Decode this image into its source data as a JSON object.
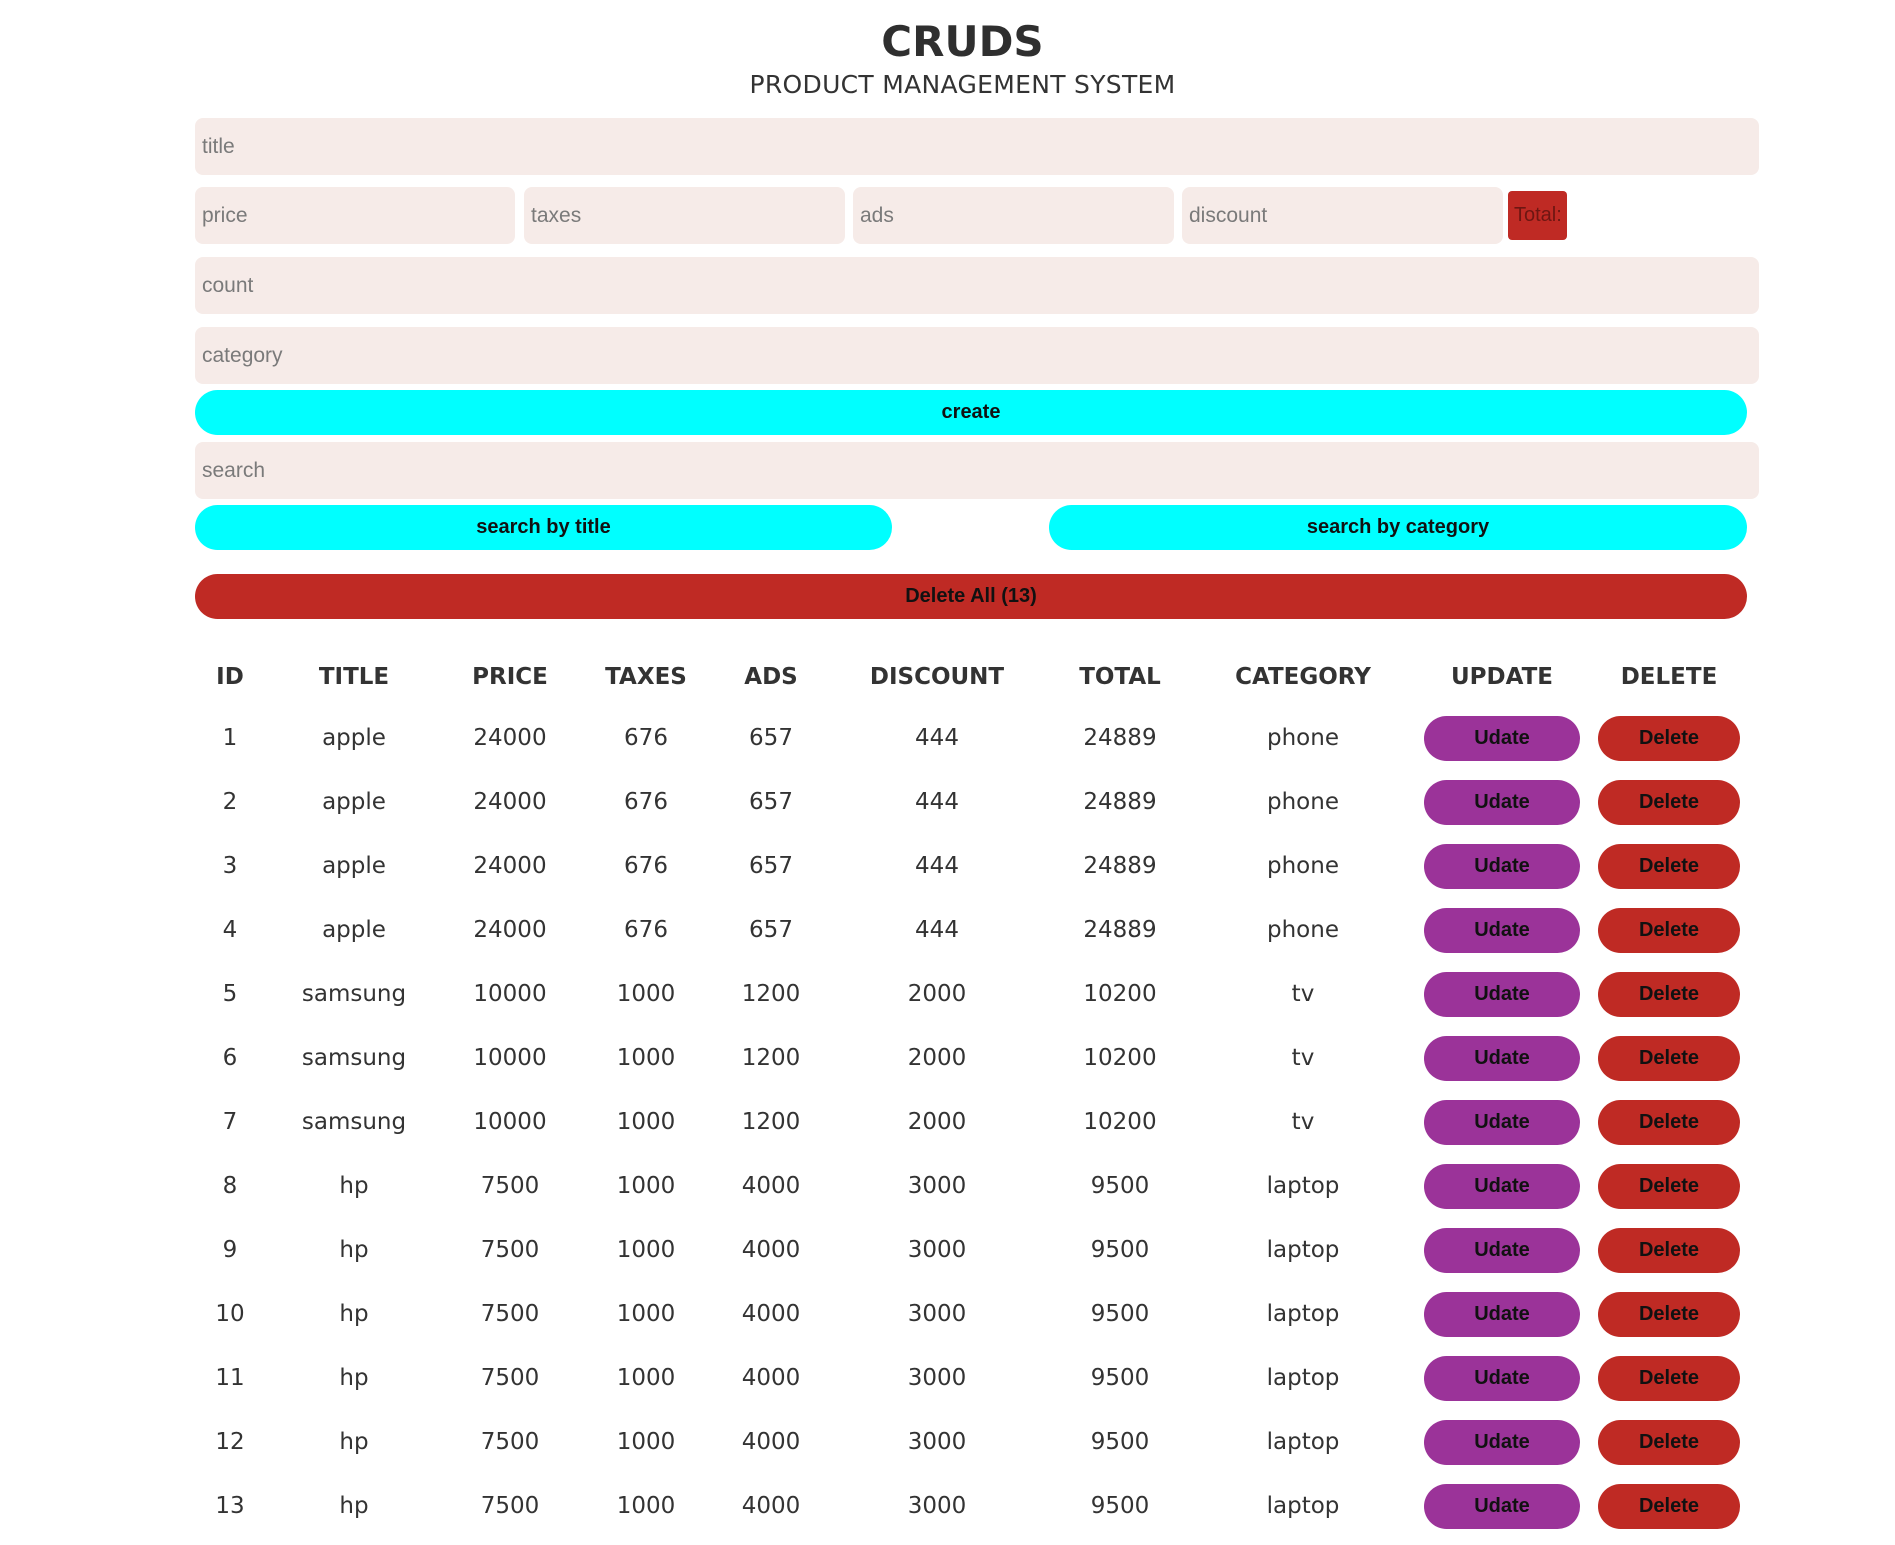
{
  "header": {
    "title": "CRUDS",
    "subtitle": "PRODUCT MANAGEMENT SYSTEM"
  },
  "form": {
    "title_placeholder": "title",
    "price_placeholder": "price",
    "taxes_placeholder": "taxes",
    "ads_placeholder": "ads",
    "discount_placeholder": "discount",
    "total_label": "Total:",
    "count_placeholder": "count",
    "category_placeholder": "category",
    "create_label": "create"
  },
  "search": {
    "placeholder": "search",
    "by_title_label": "search by title",
    "by_category_label": "search by category"
  },
  "delete_all_label": "Delete All (13)",
  "table": {
    "headers": [
      "ID",
      "TITLE",
      "PRICE",
      "TAXES",
      "ADS",
      "DISCOUNT",
      "TOTAL",
      "CATEGORY",
      "UPDATE",
      "DELETE"
    ],
    "update_label": "Udate",
    "delete_label": "Delete",
    "rows": [
      {
        "id": "1",
        "title": "apple",
        "price": "24000",
        "taxes": "676",
        "ads": "657",
        "discount": "444",
        "total": "24889",
        "category": "phone"
      },
      {
        "id": "2",
        "title": "apple",
        "price": "24000",
        "taxes": "676",
        "ads": "657",
        "discount": "444",
        "total": "24889",
        "category": "phone"
      },
      {
        "id": "3",
        "title": "apple",
        "price": "24000",
        "taxes": "676",
        "ads": "657",
        "discount": "444",
        "total": "24889",
        "category": "phone"
      },
      {
        "id": "4",
        "title": "apple",
        "price": "24000",
        "taxes": "676",
        "ads": "657",
        "discount": "444",
        "total": "24889",
        "category": "phone"
      },
      {
        "id": "5",
        "title": "samsung",
        "price": "10000",
        "taxes": "1000",
        "ads": "1200",
        "discount": "2000",
        "total": "10200",
        "category": "tv"
      },
      {
        "id": "6",
        "title": "samsung",
        "price": "10000",
        "taxes": "1000",
        "ads": "1200",
        "discount": "2000",
        "total": "10200",
        "category": "tv"
      },
      {
        "id": "7",
        "title": "samsung",
        "price": "10000",
        "taxes": "1000",
        "ads": "1200",
        "discount": "2000",
        "total": "10200",
        "category": "tv"
      },
      {
        "id": "8",
        "title": "hp",
        "price": "7500",
        "taxes": "1000",
        "ads": "4000",
        "discount": "3000",
        "total": "9500",
        "category": "laptop"
      },
      {
        "id": "9",
        "title": "hp",
        "price": "7500",
        "taxes": "1000",
        "ads": "4000",
        "discount": "3000",
        "total": "9500",
        "category": "laptop"
      },
      {
        "id": "10",
        "title": "hp",
        "price": "7500",
        "taxes": "1000",
        "ads": "4000",
        "discount": "3000",
        "total": "9500",
        "category": "laptop"
      },
      {
        "id": "11",
        "title": "hp",
        "price": "7500",
        "taxes": "1000",
        "ads": "4000",
        "discount": "3000",
        "total": "9500",
        "category": "laptop"
      },
      {
        "id": "12",
        "title": "hp",
        "price": "7500",
        "taxes": "1000",
        "ads": "4000",
        "discount": "3000",
        "total": "9500",
        "category": "laptop"
      },
      {
        "id": "13",
        "title": "hp",
        "price": "7500",
        "taxes": "1000",
        "ads": "4000",
        "discount": "3000",
        "total": "9500",
        "category": "laptop"
      }
    ]
  },
  "colors": {
    "input_bg": "#f6ebe8",
    "cyan_button": "#00ffff",
    "red_button": "#bf2a24",
    "purple_button": "#9b3399"
  }
}
